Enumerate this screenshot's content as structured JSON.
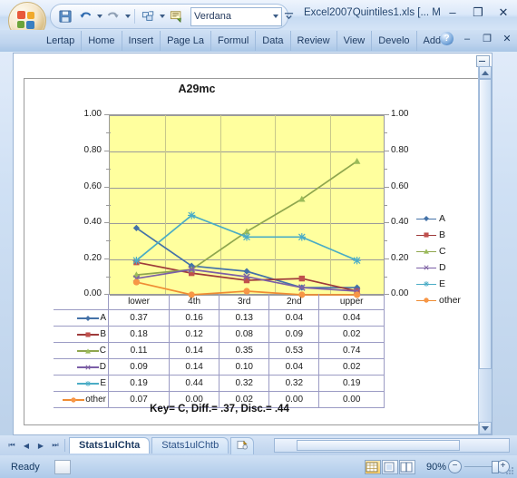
{
  "titlebar": {
    "document_title": "Excel2007Quintiles1.xls  [... M",
    "font_name": "Verdana",
    "quick_access": [
      {
        "name": "save-icon",
        "label": "💾"
      },
      {
        "name": "undo-icon",
        "label": "↶"
      },
      {
        "name": "redo-icon",
        "label": "↷"
      }
    ],
    "window_buttons": {
      "minimize": "–",
      "maximize": "❐",
      "close": "✕"
    }
  },
  "ribbon": {
    "tabs": [
      "Lertap",
      "Home",
      "Insert",
      "Page La",
      "Formul",
      "Data",
      "Review",
      "View",
      "Develo",
      "Add-In"
    ],
    "help": "?",
    "minimize": "–",
    "restore": "❐",
    "close": "✕"
  },
  "chart": {
    "title": "A29mc",
    "note": "Key= C,  Diff.= .37,  Disc.= .44",
    "plot_bg": "#ffff9e"
  },
  "chart_data": {
    "type": "line",
    "title": "A29mc",
    "xlabel": "",
    "ylabel": "",
    "categories": [
      "lower",
      "4th",
      "3rd",
      "2nd",
      "upper"
    ],
    "ylim": [
      0.0,
      1.0
    ],
    "ytick_labels": [
      "0.00",
      "0.20",
      "0.40",
      "0.60",
      "0.80",
      "1.00"
    ],
    "ytick_values": [
      0.0,
      0.2,
      0.4,
      0.6,
      0.8,
      1.0
    ],
    "grid": true,
    "dual_axis": true,
    "legend_position": "right",
    "series": [
      {
        "name": "A",
        "color": "#4472a8",
        "marker": "diamond",
        "values": [
          0.37,
          0.16,
          0.13,
          0.04,
          0.04
        ]
      },
      {
        "name": "B",
        "color": "#9e3a3a",
        "marker": "square",
        "values": [
          0.18,
          0.12,
          0.08,
          0.09,
          0.02
        ]
      },
      {
        "name": "C",
        "color": "#8fa64e",
        "marker": "triangle",
        "values": [
          0.11,
          0.14,
          0.35,
          0.53,
          0.74
        ]
      },
      {
        "name": "D",
        "color": "#7b5ea7",
        "marker": "cross",
        "values": [
          0.09,
          0.14,
          0.1,
          0.04,
          0.02
        ]
      },
      {
        "name": "E",
        "color": "#4aacc5",
        "marker": "star",
        "values": [
          0.19,
          0.44,
          0.32,
          0.32,
          0.19
        ]
      },
      {
        "name": "other",
        "color": "#ef8c33",
        "marker": "circle",
        "values": [
          0.07,
          0.0,
          0.02,
          0.0,
          0.0
        ]
      }
    ],
    "table_display": {
      "columns": [
        "lower",
        "4th",
        "3rd",
        "2nd",
        "upper"
      ],
      "rows": [
        {
          "key": "A",
          "cells": [
            "0.37",
            "0.16",
            "0.13",
            "0.04",
            "0.04"
          ]
        },
        {
          "key": "B",
          "cells": [
            "0.18",
            "0.12",
            "0.08",
            "0.09",
            "0.02"
          ]
        },
        {
          "key": "C",
          "cells": [
            "0.11",
            "0.14",
            "0.35",
            "0.53",
            "0.74"
          ]
        },
        {
          "key": "D",
          "cells": [
            "0.09",
            "0.14",
            "0.10",
            "0.04",
            "0.02"
          ]
        },
        {
          "key": "E",
          "cells": [
            "0.19",
            "0.44",
            "0.32",
            "0.32",
            "0.19"
          ]
        },
        {
          "key": "other",
          "cells": [
            "0.07",
            "0.00",
            "0.02",
            "0.00",
            "0.00"
          ]
        }
      ]
    }
  },
  "sheet_tabs": {
    "tabs": [
      {
        "label": "Stats1ulChta",
        "active": true
      },
      {
        "label": "Stats1ulChtb",
        "active": false
      }
    ],
    "nav": {
      "first": "⏮",
      "prev": "◀",
      "next": "▶",
      "last": "⏭"
    }
  },
  "statusbar": {
    "status": "Ready",
    "zoom": "90%",
    "zoom_out": "−",
    "zoom_in": "+"
  }
}
